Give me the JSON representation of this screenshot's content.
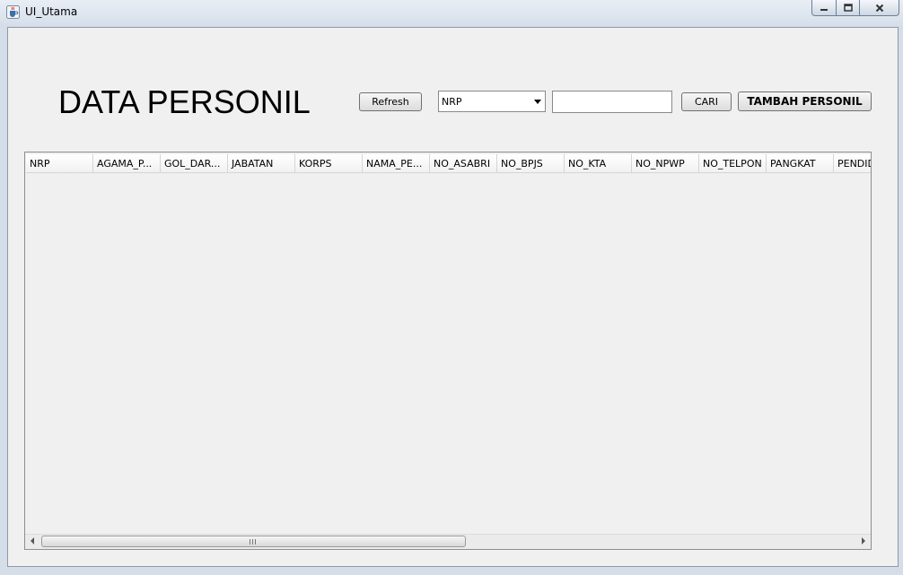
{
  "window": {
    "title": "UI_Utama",
    "icon": "java-cup-icon"
  },
  "header": {
    "title": "DATA PERSONIL"
  },
  "toolbar": {
    "refresh_label": "Refresh",
    "search_field_selected": "NRP",
    "search_value": "",
    "cari_label": "CARI",
    "tambah_label": "TAMBAH PERSONIL"
  },
  "table": {
    "columns": [
      "NRP",
      "AGAMA_P...",
      "GOL_DAR...",
      "JABATAN",
      "KORPS",
      "NAMA_PE...",
      "NO_ASABRI",
      "NO_BPJS",
      "NO_KTA",
      "NO_NPWP",
      "NO_TELPON",
      "PANGKAT",
      "PENDIDI"
    ],
    "rows": []
  }
}
